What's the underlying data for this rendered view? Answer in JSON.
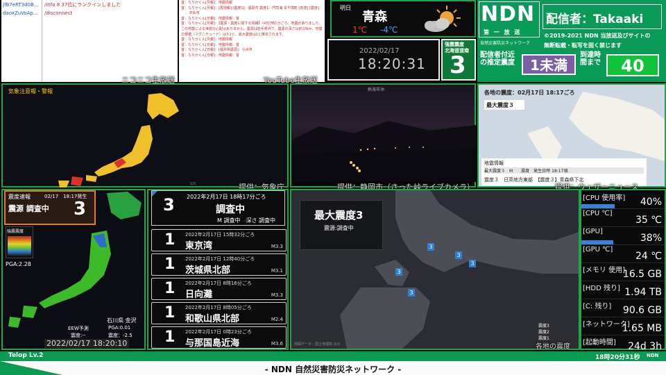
{
  "chat": {
    "users": [
      "JfB7eRT3d0B...",
      "daoxZuVoAp..."
    ],
    "commands": [
      "/info 8 37位にランクインしました",
      "/disconnect"
    ],
    "log": [
      "昔：なりかくん[月報]：地震情報",
      "昔：なりかくん[月報]：[再現報] [震度1]：福岡市 震度1：門司海 青千境町 [有感] [震度]：",
      "　 ：天仙市",
      "昔：なりかくん[日報]：地震情報：昔",
      "昔：なりかくん[月報]：【震源・震度に関する情報】（4日7時1分ごろ、地震がありました。この地震による津波の心配はありません。震源は岩手県沖で、震源の深さは約10km、地震の規模（マグニチュード）は3.2と、最大震度は1と推定されます。",
      "昔：なりかくん[月報]：地震情報",
      "昔：なりかくん[日報]：地震情報：昔",
      "昔：なりかくん[日報]：[福井県震源]：小浜市",
      "昔：なりかくん[日報]：地震情報：昔"
    ]
  },
  "labels": {
    "niconico": "ニコニコ生放送",
    "youtube": "YouTube生放送",
    "credit_jma": "提供：気象庁",
    "credit_camera": "提供：静岡市（さった峠ライブカメラ）",
    "credit_wn": "提供：ウェザーニュース",
    "map_warning_title": "気象注意報・警報",
    "camera_title": "熱海市沖"
  },
  "weather": {
    "day": "明日",
    "city": "青森",
    "high": "1℃",
    "low": "-4℃",
    "high_color": "#ff3b30",
    "low_color": "#3fa4ff"
  },
  "clock": {
    "date": "2022/02/17",
    "time": "18:20:31"
  },
  "max_intensity": {
    "label": "強震震度",
    "region": "北海道道南",
    "value": "3"
  },
  "ndn": {
    "logo": "NDN",
    "logo_sub": "第 一 放 送",
    "logo_sub2": "自然災害防災ネットワーク",
    "streamer_label": "配信者：Takaaki",
    "copyright1": "©2019-2021 NDN 当放送及びサイトの",
    "copyright2": "無断転載・転写を固く禁じます",
    "est_label": "配信者付近の推定震度",
    "est_value": "1未満",
    "arrival_label": "到達時間まで",
    "arrival_value": "40"
  },
  "wn_panel": {
    "header": "各地の震度：02月17日 18:17ごろ",
    "max": "最大震度３",
    "info_title": "地震情報",
    "info_line1": "最大震度３　M　　震度　発生日時 18:17頃",
    "info_line2": "震度３　日高地方東部　【震度３】青森県下北"
  },
  "eew": {
    "header": "震度速報",
    "time": "02/17　18:17発生",
    "epicenter": "震源 調査中",
    "value": "3",
    "legend_title": "強震震度",
    "pga": "PGA:2.28",
    "location": "石川県 金沢",
    "eew_label": "EEW予測",
    "pga2": "PGA:0.01",
    "intensity": "震度:--",
    "intensity2": "震度：-2.5",
    "timestamp": "2022/02/17 18:20:10"
  },
  "quakes": {
    "top": {
      "time": "2022年2月17日 18時17分ごろ",
      "place": "調査中",
      "value": "3",
      "extra": "M 調査中　深さ 調査中"
    },
    "list": [
      {
        "n": "1",
        "time": "2022年2月17日 15時32分ごろ",
        "place": "東京湾",
        "m": "M3.3"
      },
      {
        "n": "1",
        "time": "2022年2月17日 12時40分ごろ",
        "place": "茨城県北部",
        "m": "M3.1"
      },
      {
        "n": "1",
        "time": "2022年2月17日 8時16分ごろ",
        "place": "日向灘",
        "m": "M3.3"
      },
      {
        "n": "1",
        "time": "2022年2月17日 8時05分ごろ",
        "place": "和歌山県北部",
        "m": "M2.4"
      },
      {
        "n": "1",
        "time": "2022年2月17日 0時23分ごろ",
        "place": "与那国島近海",
        "m": "M3.6"
      }
    ]
  },
  "center_map": {
    "title": "最大震度3",
    "subtitle": "震源:調査中",
    "legend": [
      "震度3",
      "震度2",
      "震度1"
    ],
    "caption": "各地の震度",
    "attrib": "地図データ：国土地理院 ほか"
  },
  "system": [
    {
      "k": "[CPU 使用率]",
      "v": "40%",
      "bar": 40
    },
    {
      "k": "[CPU ℃]",
      "v": "35 ℃"
    },
    {
      "k": "[GPU]",
      "v": "38%",
      "bar": 38
    },
    {
      "k": "[GPU ℃]",
      "v": "24 ℃"
    },
    {
      "k": "[メモリ 使用]",
      "v": "16.5 GB"
    },
    {
      "k": "[HDD 残り]",
      "v": "1.94 TB"
    },
    {
      "k": "[C: 残り]",
      "v": "90.6 GB"
    },
    {
      "k": "[ネットワーク]",
      "v": "1.65 MB"
    },
    {
      "k": "[起動時間]",
      "v": "24d 3h"
    }
  ],
  "footer": {
    "telop": "Telop Lv.2",
    "time": "18時20分31秒",
    "brand": "NDN",
    "title": "- NDN 自然災害防災ネットワーク -"
  }
}
